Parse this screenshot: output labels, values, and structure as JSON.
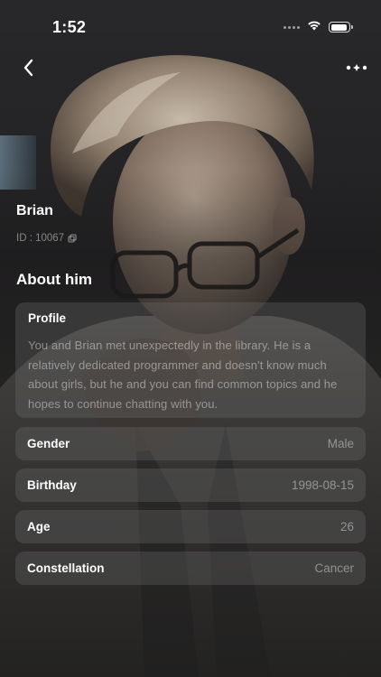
{
  "status_bar": {
    "time": "1:52",
    "icons": [
      "cellular-dots-icon",
      "wifi-icon",
      "battery-icon"
    ]
  },
  "nav": {
    "back_icon": "chevron-left-icon",
    "more_icon": "more-dots-icon"
  },
  "character": {
    "name": "Brian",
    "id_text": "ID : 10067",
    "copy_icon": "copy-icon"
  },
  "about": {
    "title": "About him",
    "profile_label": "Profile",
    "profile_text": "You and Brian met unexpectedly in the library. He is a relatively dedicated programmer and doesn't know much about girls, but he and you can find common topics and he hopes to continue chatting with you.",
    "rows": [
      {
        "label": "Gender",
        "value": "Male"
      },
      {
        "label": "Birthday",
        "value": "1998-08-15"
      },
      {
        "label": "Age",
        "value": "26"
      },
      {
        "label": "Constellation",
        "value": "Cancer"
      }
    ]
  },
  "colors": {
    "card_bg": "#5a5a5a",
    "muted_text": "#8e8e8e",
    "text": "#ffffff"
  }
}
